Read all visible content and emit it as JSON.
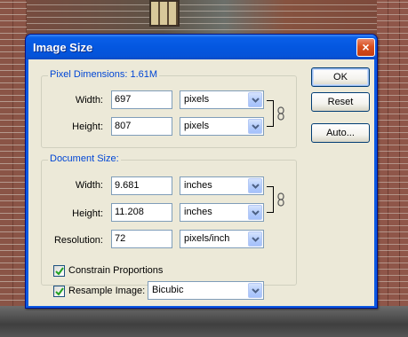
{
  "dialog": {
    "title": "Image Size",
    "close_label": "×"
  },
  "buttons": {
    "ok": "OK",
    "reset": "Reset",
    "auto": "Auto..."
  },
  "pixel_dimensions": {
    "legend": "Pixel Dimensions:",
    "size": "1.61M",
    "width": {
      "label": "Width:",
      "value": "697",
      "unit": "pixels"
    },
    "height": {
      "label": "Height:",
      "value": "807",
      "unit": "pixels"
    }
  },
  "document_size": {
    "legend": "Document Size:",
    "width": {
      "label": "Width:",
      "value": "9.681",
      "unit": "inches"
    },
    "height": {
      "label": "Height:",
      "value": "11.208",
      "unit": "inches"
    },
    "resolution": {
      "label": "Resolution:",
      "value": "72",
      "unit": "pixels/inch"
    }
  },
  "options": {
    "constrain": {
      "label": "Constrain Proportions",
      "checked": true
    },
    "resample": {
      "label": "Resample Image:",
      "checked": true,
      "method": "Bicubic"
    }
  },
  "colors": {
    "title_bar": "#0a58e2",
    "group_label": "#0046d5",
    "client_bg": "#ece9d8",
    "close_button": "#d8501f"
  }
}
